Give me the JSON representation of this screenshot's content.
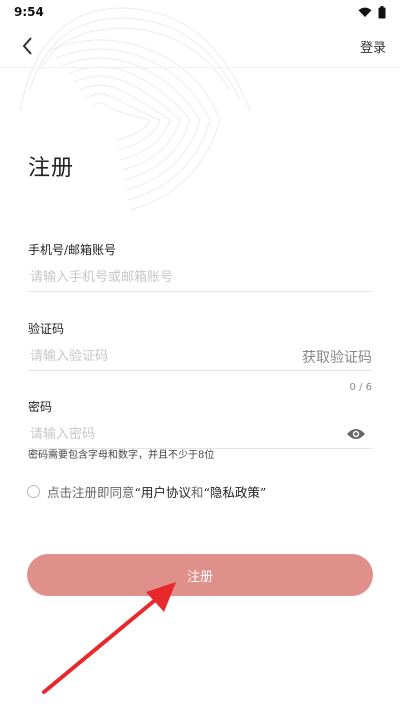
{
  "status": {
    "time": "9:54",
    "wifi_icon": "wifi-icon",
    "battery_icon": "battery-icon"
  },
  "header": {
    "back_icon": "chevron-left-icon",
    "login_label": "登录"
  },
  "page": {
    "title": "注册"
  },
  "fields": {
    "account": {
      "label": "手机号/邮箱账号",
      "placeholder": "请输入手机号或邮箱账号",
      "value": ""
    },
    "code": {
      "label": "验证码",
      "placeholder": "请输入验证码",
      "value": "",
      "get_code_label": "获取验证码",
      "counter": "0 / 6"
    },
    "password": {
      "label": "密码",
      "placeholder": "请输入密码",
      "value": "",
      "toggle_icon": "eye-icon",
      "hint": "密码需要包含字母和数字，并且不少于8位"
    }
  },
  "agreement": {
    "prefix": "点击注册即同意",
    "quote_open_1": "“",
    "user_agreement": "用户协议",
    "conj": "和",
    "quote_open_2": "“",
    "privacy_policy": "隐私政策",
    "quote_close": "”",
    "checked": false
  },
  "submit": {
    "label": "注册"
  },
  "colors": {
    "primary": "#e0908b",
    "annotation_arrow": "#e8292b"
  }
}
